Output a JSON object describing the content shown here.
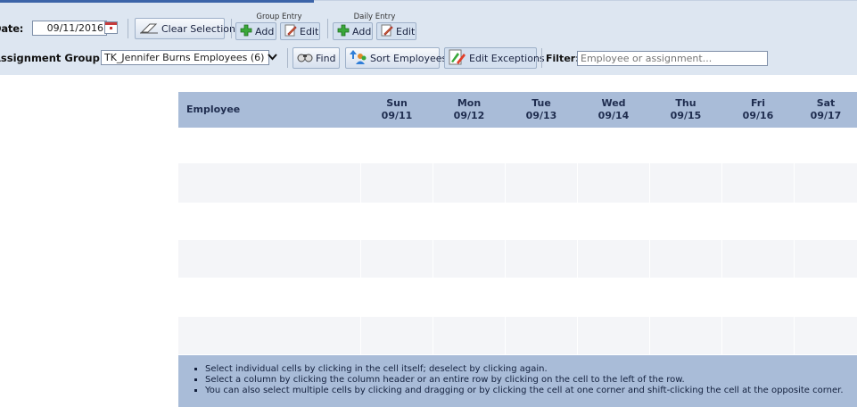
{
  "toolbar": {
    "date_label": "Date:",
    "date_value": "09/11/2016",
    "clear_selection": "Clear Selection",
    "group_entry_caption": "Group Entry",
    "daily_entry_caption": "Daily Entry",
    "add_label": "Add",
    "edit_label": "Edit",
    "assignment_group_label": "Assignment Group:",
    "assignment_group_value": "TK_Jennifer Burns Employees (6)",
    "find_label": "Find",
    "sort_employees_label": "Sort Employees",
    "edit_exceptions_label": "Edit Exceptions",
    "filter_label": "Filter:",
    "filter_placeholder": "Employee or assignment..."
  },
  "grid": {
    "employee_header": "Employee",
    "days": [
      {
        "name": "Sun",
        "date": "09/11"
      },
      {
        "name": "Mon",
        "date": "09/12"
      },
      {
        "name": "Tue",
        "date": "09/13"
      },
      {
        "name": "Wed",
        "date": "09/14"
      },
      {
        "name": "Thu",
        "date": "09/15"
      },
      {
        "name": "Fri",
        "date": "09/16"
      },
      {
        "name": "Sat",
        "date": "09/17"
      }
    ]
  },
  "hints": [
    "Select individual cells by clicking in the cell itself; deselect by clicking again.",
    "Select a column by clicking the column header or an entire row by clicking on the cell to the left of the row.",
    "You can also select multiple cells by clicking and dragging or by clicking the cell at one corner and shift-clicking the cell at the opposite corner."
  ],
  "colors": {
    "toolbar_bg": "#dde6f1",
    "header_bg": "#a9bcd8",
    "row_alt_bg": "#f4f5f8",
    "accent": "#3c64a8"
  }
}
